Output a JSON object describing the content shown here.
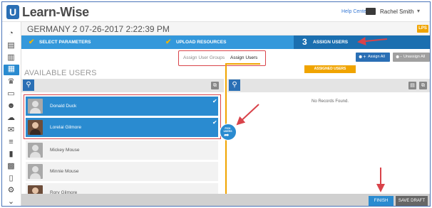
{
  "app": {
    "brand": "Learn-Wise",
    "help_link": "Help Center",
    "user_name": "Rachel Smith"
  },
  "page": {
    "title": "GERMANY 2 07-26-2017 2:22:39 PM",
    "badge": "LPS"
  },
  "steps": [
    {
      "label": "SELECT PARAMETERS",
      "status": "complete"
    },
    {
      "label": "UPLOAD RESOURCES",
      "status": "complete"
    },
    {
      "number": "3",
      "label": "ASSIGN USERS",
      "status": "active"
    }
  ],
  "tabs": [
    {
      "label": "Assign User Groups",
      "active": false
    },
    {
      "label": "Assign Users",
      "active": true
    }
  ],
  "actions": {
    "assign_all": "Assign All",
    "unassign_all": "Unassign All",
    "finish": "FINISH",
    "save_draft": "SAVE DRAFT"
  },
  "available": {
    "title": "AVAILABLE USERS",
    "users": [
      {
        "name": "Donald Duck",
        "selected": true,
        "photo": false
      },
      {
        "name": "Lorelai Gilmore",
        "selected": true,
        "photo": true
      },
      {
        "name": "Mickey Mouse",
        "selected": false,
        "photo": false
      },
      {
        "name": "Minnie Mouse",
        "selected": false,
        "photo": false
      },
      {
        "name": "Rory Gilmore",
        "selected": false,
        "photo": true
      }
    ]
  },
  "assigned": {
    "tag": "ASSIGNED USERS",
    "empty_text": "No Records Found."
  },
  "pick_button": {
    "label_line1": "PICK",
    "label_line2": "USERS"
  },
  "colors": {
    "primary": "#3498db",
    "primary_dark": "#1b6fb0",
    "accent": "#f0a400",
    "annotation": "#d9434a"
  }
}
